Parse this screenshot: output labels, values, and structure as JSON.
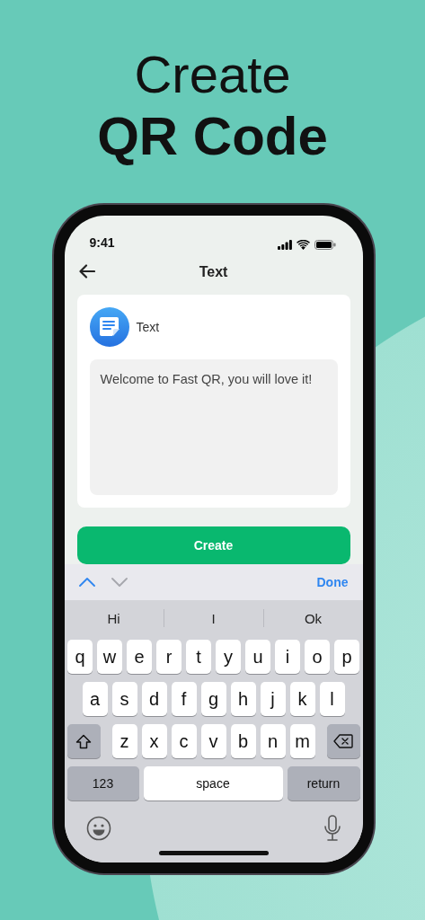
{
  "headline": {
    "line_1": "Create",
    "line_2": "QR Code"
  },
  "status_bar": {
    "time": "9:41"
  },
  "nav": {
    "title": "Text"
  },
  "card": {
    "label": "Text",
    "text": "Welcome to Fast QR, you will love it!"
  },
  "primary_button": "Create",
  "accessory_bar": {
    "previous_disabled": false,
    "next_disabled": true,
    "done": "Done"
  },
  "suggestions": [
    "Hi",
    "I",
    "Ok"
  ],
  "keyboard_rows": [
    [
      {
        "kind": "letter",
        "label": "q"
      },
      {
        "kind": "letter",
        "label": "w"
      },
      {
        "kind": "letter",
        "label": "e"
      },
      {
        "kind": "letter",
        "label": "r"
      },
      {
        "kind": "letter",
        "label": "t"
      },
      {
        "kind": "letter",
        "label": "y"
      },
      {
        "kind": "letter",
        "label": "u"
      },
      {
        "kind": "letter",
        "label": "i"
      },
      {
        "kind": "letter",
        "label": "o"
      },
      {
        "kind": "letter",
        "label": "p"
      }
    ],
    [
      {
        "kind": "letter",
        "label": "a"
      },
      {
        "kind": "letter",
        "label": "s"
      },
      {
        "kind": "letter",
        "label": "d"
      },
      {
        "kind": "letter",
        "label": "f"
      },
      {
        "kind": "letter",
        "label": "g"
      },
      {
        "kind": "letter",
        "label": "h"
      },
      {
        "kind": "letter",
        "label": "j"
      },
      {
        "kind": "letter",
        "label": "k"
      },
      {
        "kind": "letter",
        "label": "l"
      }
    ],
    [
      {
        "kind": "shift"
      },
      {
        "kind": "letter",
        "label": "z"
      },
      {
        "kind": "letter",
        "label": "x"
      },
      {
        "kind": "letter",
        "label": "c"
      },
      {
        "kind": "letter",
        "label": "v"
      },
      {
        "kind": "letter",
        "label": "b"
      },
      {
        "kind": "letter",
        "label": "n"
      },
      {
        "kind": "letter",
        "label": "m"
      },
      {
        "kind": "delete"
      }
    ],
    [
      {
        "kind": "mode",
        "label": "123"
      },
      {
        "kind": "space",
        "label": "space"
      },
      {
        "kind": "return",
        "label": "return"
      }
    ]
  ]
}
